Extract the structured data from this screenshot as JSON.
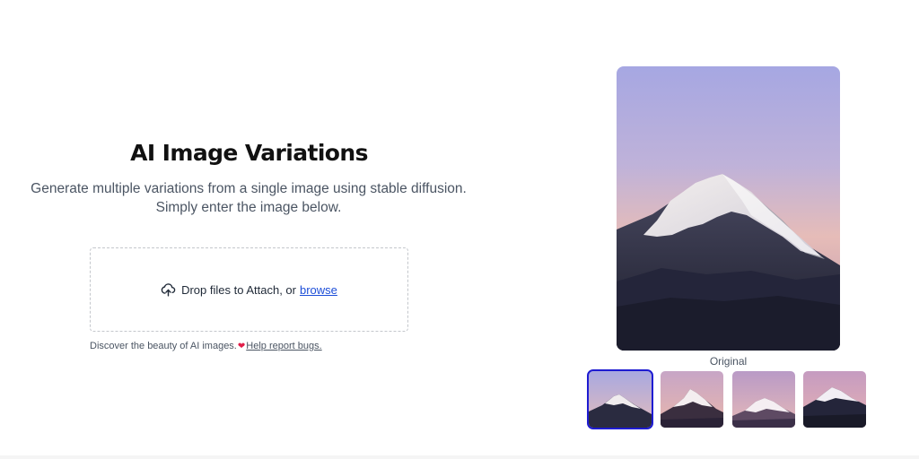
{
  "hero": {
    "title": "AI Image Variations",
    "subtitle": "Generate multiple variations from a single image using stable diffusion. Simply enter the image below."
  },
  "upload": {
    "icon": "upload-cloud-icon",
    "prompt": "Drop files to Attach, or",
    "browse_label": "browse"
  },
  "footer_note": {
    "text": "Discover the beauty of AI images.",
    "heart_icon": "heart-icon",
    "link_label": "Help report bugs."
  },
  "preview": {
    "caption": "Original",
    "selected_index": 0
  },
  "colors": {
    "accent": "#1e1bd1",
    "link": "#1d4ed8",
    "heart": "#e11d48"
  }
}
